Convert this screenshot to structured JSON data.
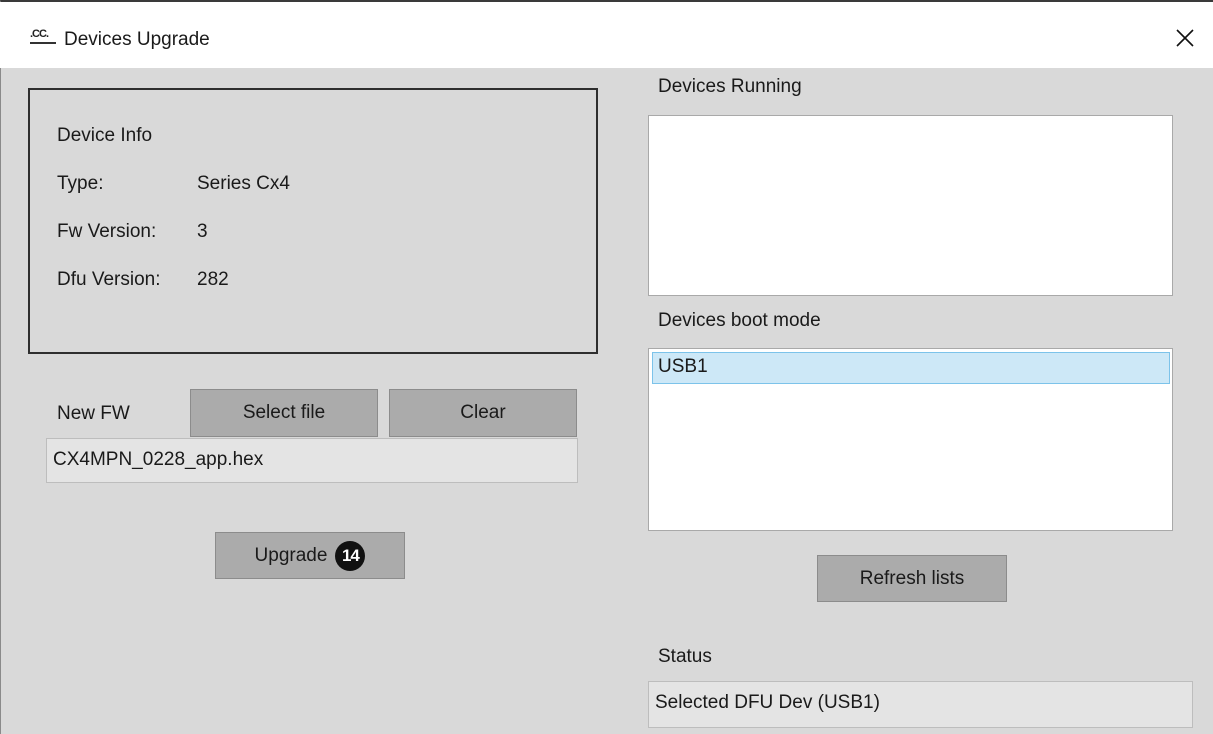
{
  "window": {
    "title": "Devices Upgrade",
    "logo_text": ".CC."
  },
  "device_info": {
    "heading": "Device Info",
    "rows": [
      {
        "label": "Type:",
        "value": "Series Cx4"
      },
      {
        "label": "Fw Version:",
        "value": "3"
      },
      {
        "label": "Dfu Version:",
        "value": "282"
      }
    ]
  },
  "new_fw": {
    "label": "New FW",
    "select_file_label": "Select file",
    "clear_label": "Clear",
    "file_value": "CX4MPN_0228_app.hex"
  },
  "upgrade": {
    "label": "Upgrade",
    "step_badge": "14"
  },
  "devices_running": {
    "label": "Devices Running",
    "items": []
  },
  "devices_boot_mode": {
    "label": "Devices boot mode",
    "items": [
      "USB1"
    ],
    "selected": "USB1"
  },
  "refresh": {
    "label": "Refresh lists"
  },
  "status": {
    "label": "Status",
    "value": "Selected DFU Dev (USB1)"
  },
  "colors": {
    "window_bg": "#d9d9d9",
    "button_bg": "#ababab",
    "selection_bg": "#cde8f7",
    "selection_border": "#7cc3ea"
  }
}
